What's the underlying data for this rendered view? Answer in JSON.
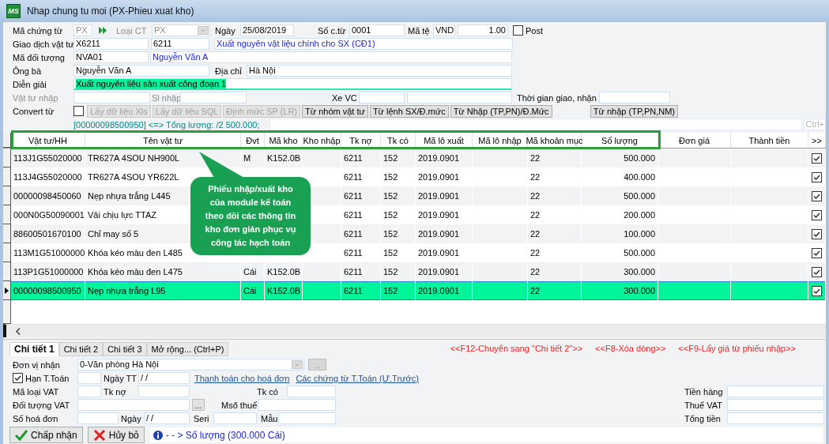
{
  "window": {
    "logo": "MS",
    "title": "Nhap chung tu moi (PX-Phieu xuat kho)"
  },
  "voucher": {
    "doc_code": {
      "label": "Mã chứng từ",
      "value": "PX",
      "disabled": true
    },
    "doc_type": {
      "label": "Loại CT",
      "value": "PX",
      "disabled": true
    },
    "date": {
      "label": "Ngày",
      "value": "25/08/2019"
    },
    "doc_no": {
      "label": "Số c.từ",
      "value": "0001"
    },
    "currency": {
      "label": "Mã tệ",
      "code": "VND",
      "rate": "1.00"
    },
    "post": {
      "label": "Post",
      "checked": false
    },
    "transaction": {
      "label": "Giao dịch vật tư",
      "code": "X6211",
      "account": "6211",
      "description": "Xuất nguyên vật liệu chính cho SX (CĐ1)"
    },
    "partner": {
      "label": "Mã đối tượng",
      "code": "NVA01",
      "name": "Nguyễn Văn A"
    },
    "contact": {
      "label": "Ông bà",
      "value": "Nguyễn Văn A"
    },
    "address": {
      "label": "Địa chỉ",
      "value": "Hà Nội"
    },
    "memo": {
      "label": "Diễn giải",
      "value": "Xuất nguyên liệu sản xuất công đoạn 1",
      "highlighted": true
    },
    "import_item": {
      "label": "Vật tư nhập",
      "disabled": true
    },
    "import_qty": {
      "label": "Sl nhập",
      "disabled": true
    },
    "vehicle": {
      "label": "Xe VC"
    },
    "delivery_time": {
      "label": "Thời gian giao, nhận"
    },
    "convert": {
      "label": "Convert từ",
      "checked": false
    },
    "convert_buttons": [
      {
        "label": "Lấy dữ liệu Xls",
        "disabled": true
      },
      {
        "label": "Lấy dữ liệu SQL",
        "disabled": true
      },
      {
        "label": "Định mức SP (LR)",
        "disabled": true
      },
      {
        "label": "Từ nhóm vật tư",
        "disabled": false
      },
      {
        "label": "Từ lệnh SX/Đ.mức",
        "disabled": false
      },
      {
        "label": "Từ Nhập (TP,PN)/Đ.Mức",
        "disabled": false
      }
    ],
    "extra_button": {
      "label": "Từ nhập (TP,PN,NM)",
      "disabled": false
    },
    "summary": "[00000098500950] <=> Tổng lượng: /2 500.000;",
    "shortcut_hint": "Ctrl+"
  },
  "table": {
    "columns": [
      "Vật tư/HH",
      "Tên vật tư",
      "Đvt",
      "Mã kho",
      "Kho nhập",
      "Tk nợ",
      "Tk có",
      "Mã lô xuất",
      "Mã lô nhập",
      "Mã khoản mục",
      "Số lượng",
      "Đơn giá",
      "Thành tiền",
      ">>"
    ],
    "rows": [
      {
        "item_code": "113J1G55020000",
        "name": "TR627A 4SOU NH900L",
        "unit": "M",
        "warehouse": "K152.0B",
        "debit": "6211",
        "credit": "152",
        "lot_out": "2019.0901",
        "expense_code": "22",
        "quantity": "500.000",
        "checked": true,
        "selected": false
      },
      {
        "item_code": "113J4G55020000",
        "name": "TR627A 4SOU YR622L",
        "debit": "6211",
        "credit": "152",
        "lot_out": "2019.0901",
        "expense_code": "22",
        "quantity": "400.000",
        "checked": true,
        "selected": false
      },
      {
        "item_code": "00000098450060",
        "name": "Nẹp nhựa trắng L445",
        "debit": "6211",
        "credit": "152",
        "lot_out": "2019.0901",
        "expense_code": "22",
        "quantity": "500.000",
        "checked": true,
        "selected": false
      },
      {
        "item_code": "000N0G50090001",
        "name": "Vải chịu lực TTAZ",
        "debit": "6211",
        "credit": "152",
        "lot_out": "2019.0901",
        "expense_code": "22",
        "quantity": "200.000",
        "checked": true,
        "selected": false
      },
      {
        "item_code": "88600501670100",
        "name": "Chỉ may số 5",
        "debit": "6211",
        "credit": "152",
        "lot_out": "2019.0901",
        "expense_code": "22",
        "quantity": "100.000",
        "checked": true,
        "selected": false
      },
      {
        "item_code": "113M1G51000000",
        "name": "Khóa kéo màu đen L485",
        "debit": "6211",
        "credit": "152",
        "lot_out": "2019.0901",
        "expense_code": "22",
        "quantity": "500.000",
        "checked": true,
        "selected": false
      },
      {
        "item_code": "113P1G51000000",
        "name": "Khóa kéo màu đen L475",
        "unit": "Cái",
        "warehouse": "K152.0B",
        "debit": "6211",
        "credit": "152",
        "lot_out": "2019.0901",
        "expense_code": "22",
        "quantity": "300.000",
        "checked": true,
        "selected": false
      },
      {
        "item_code": "00000098500950",
        "name": "Nẹp nhựa trắng L95",
        "unit": "Cái",
        "warehouse": "K152.0B",
        "debit": "6211",
        "credit": "152",
        "lot_out": "2019.0901",
        "expense_code": "22",
        "quantity": "300.000",
        "checked": true,
        "selected": true
      }
    ]
  },
  "callout": {
    "text": "Phiếu nhập/xuất kho của module kế toán theo dõi các thông tin kho đơn giản phục vụ công tác hạch toán"
  },
  "detail": {
    "tabs": [
      {
        "label": "Chi tiết 1",
        "selected": true
      },
      {
        "label": "Chi tiết 2",
        "selected": false
      },
      {
        "label": "Chi tiết 3",
        "selected": false
      },
      {
        "label": "Mở rộng... (Ctrl+P)",
        "selected": false
      }
    ],
    "hints": [
      "<<F12-Chuyển sang \"Chi tiết 2\">>",
      "<<F8-Xóa dòng>>",
      "<<F9-Lấy giá từ phiếu nhập>>"
    ],
    "receiver": {
      "label": "Đơn vị nhận",
      "value": "0-Văn phòng Hà Nội",
      "more": "..."
    },
    "due": {
      "label": "Hạn T.Toán",
      "checked": true
    },
    "pay_date": {
      "label": "Ngày TT",
      "value": "/ /"
    },
    "links": [
      "Thanh toán cho hoá đơn",
      "Các chứng từ T.Toán (Ư.Trước)"
    ],
    "vat_type": {
      "label": "Mã loại VAT"
    },
    "debit": {
      "label": "Tk nợ"
    },
    "credit": {
      "label": "Tk có"
    },
    "vat_partner": {
      "label": "Đối tượng VAT",
      "more": "..."
    },
    "tax_code": {
      "label": "Mső thuế"
    },
    "invoice_no": {
      "label": "Số hoá đơn"
    },
    "invoice_date": {
      "label": "Ngày",
      "value": "/ /"
    },
    "serial": {
      "label": "Seri"
    },
    "form_no": {
      "label": "Mẫu"
    },
    "totals": [
      {
        "label": "Tiền hàng"
      },
      {
        "label": "Thuế VAT"
      },
      {
        "label": "Tổng tiền"
      }
    ]
  },
  "actions": [
    {
      "label": "Chấp nhận",
      "kind": "accept"
    },
    {
      "label": "Hủy bỏ",
      "kind": "cancel"
    }
  ],
  "status": "- - > Số lượng (300.000 Cái)"
}
